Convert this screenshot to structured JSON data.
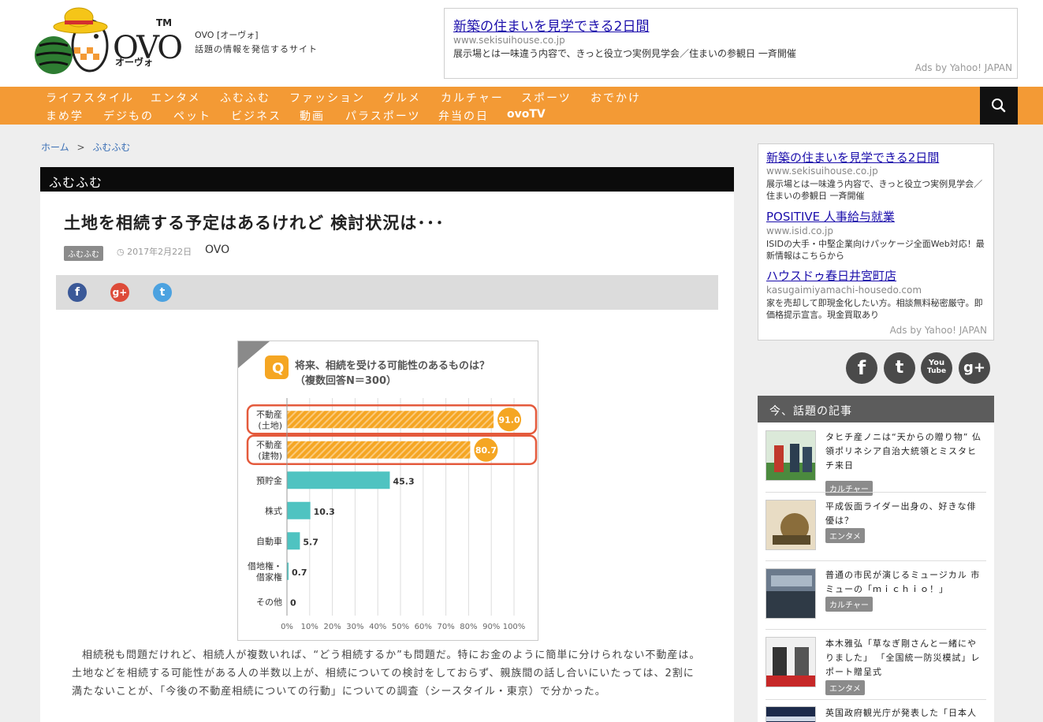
{
  "header": {
    "logo_text": "OVO",
    "logo_tm": "TM",
    "logo_kana": "オーヴォ",
    "site_name": "OVO [オーヴォ]",
    "tagline": "話題の情報を発信するサイト"
  },
  "top_ad": {
    "title": "新築の住まいを見学できる2日間",
    "url": "www.sekisuihouse.co.jp",
    "desc": "展示場とは一味違う内容で、きっと役立つ実例見学会／住まいの参観日 一斉開催",
    "by": "Ads by Yahoo! JAPAN"
  },
  "nav": {
    "row1": [
      "ライフスタイル",
      "エンタメ",
      "ふむふむ",
      "ファッション",
      "グルメ",
      "カルチャー",
      "スポーツ",
      "おでかけ"
    ],
    "row2": [
      "まめ学",
      "デジもの",
      "ペット",
      "ビジネス",
      "動画",
      "パラスポーツ",
      "弁当の日",
      "ovoTV"
    ]
  },
  "breadcrumb": {
    "home": "ホーム",
    "sep": ">",
    "current": "ふむふむ"
  },
  "category_bar": "ふむふむ",
  "article": {
    "title": "土地を相続する予定はあるけれど 検討状況は･･･",
    "category": "ふむふむ",
    "date": "2017年2月22日",
    "author": "OVO",
    "body": "相続税も問題だけれど、相続人が複数いれば、“どう相続するか”も問題だ。特にお金のように簡単に分けられない不動産は。土地などを相続する可能性がある人の半数以上が、相続についての検討をしておらず、親族間の話し合いにいたっては、2割に満たないことが、「今後の不動産相続についての行動」についての調査（シースタイル・東京）で分かった。"
  },
  "share": {
    "facebook": "f",
    "google": "g+",
    "twitter": "t"
  },
  "chart_data": {
    "type": "bar",
    "title": "将来、相続を受ける可能性のあるものは？",
    "subtitle": "（複数回答N＝300）",
    "badge": "Q",
    "categories": [
      "不動産（土地）",
      "不動産（建物）",
      "預貯金",
      "株式",
      "自動車",
      "借地権・借家権",
      "その他"
    ],
    "category_lines": [
      [
        "不動産",
        "(土地)"
      ],
      [
        "不動産",
        "(建物)"
      ],
      [
        "預貯金"
      ],
      [
        "株式"
      ],
      [
        "自動車"
      ],
      [
        "借地権・",
        "借家権"
      ],
      [
        "その他"
      ]
    ],
    "values": [
      91.0,
      80.7,
      45.3,
      10.3,
      5.7,
      0.7,
      0
    ],
    "labels": [
      "91.0",
      "80.7",
      "45.3",
      "10.3",
      "5.7",
      "0.7",
      "0"
    ],
    "highlighted": [
      true,
      true,
      false,
      false,
      false,
      false,
      false
    ],
    "xticks": [
      "0%",
      "10%",
      "20%",
      "30%",
      "40%",
      "50%",
      "60%",
      "70%",
      "80%",
      "90%",
      "100%"
    ],
    "xlim": [
      0,
      100
    ],
    "colors": {
      "highlight": "#f5a623",
      "normal": "#4fc3c1",
      "outline": "#e45a3c"
    }
  },
  "sidebar_ad": {
    "items": [
      {
        "title": "新築の住まいを見学できる2日間",
        "url": "www.sekisuihouse.co.jp",
        "desc": "展示場とは一味違う内容で、きっと役立つ実例見学会／住まいの参観日 一斉開催"
      },
      {
        "title": "POSITIVE 人事給与就業",
        "url": "www.isid.co.jp",
        "desc": "ISIDの大手・中堅企業向けパッケージ全面Web対応！最新情報はこちらから"
      },
      {
        "title": "ハウスドゥ春日井宮町店",
        "url": "kasugaimiyamachi-housedo.com",
        "desc": "家を売却して即現金化したい方。相談無料秘密厳守。即価格提示宣言。現金買取あり"
      }
    ],
    "by": "Ads by Yahoo! JAPAN"
  },
  "social": {
    "facebook": "f",
    "twitter": "t",
    "youtube_top": "You",
    "youtube_bottom": "Tube",
    "google": "g+"
  },
  "popular": {
    "heading": "今、話題の記事",
    "items": [
      {
        "title": "タヒチ産ノニは“天からの贈り物” 仏領ポリネシア自治大統領とミスタヒチ来日",
        "category": "カルチャー"
      },
      {
        "title": "平成仮面ライダー出身の、好きな俳優は？",
        "category": "エンタメ"
      },
      {
        "title": "普通の市民が演じるミュージカル 市ミューの「ｍｉｃｈｉｏ！」",
        "category": "カルチャー"
      },
      {
        "title": "本木雅弘「草なぎ剛さんと一緒にやりました」 「全国統一防災模試」レポート贈呈式",
        "category": "エンタメ"
      },
      {
        "title": "英国政府観光庁が発表した「日本人",
        "category": ""
      }
    ]
  },
  "colors": {
    "nav": "#f39a35",
    "category_bar": "#0b0b0b",
    "link": "#1a0dab"
  }
}
